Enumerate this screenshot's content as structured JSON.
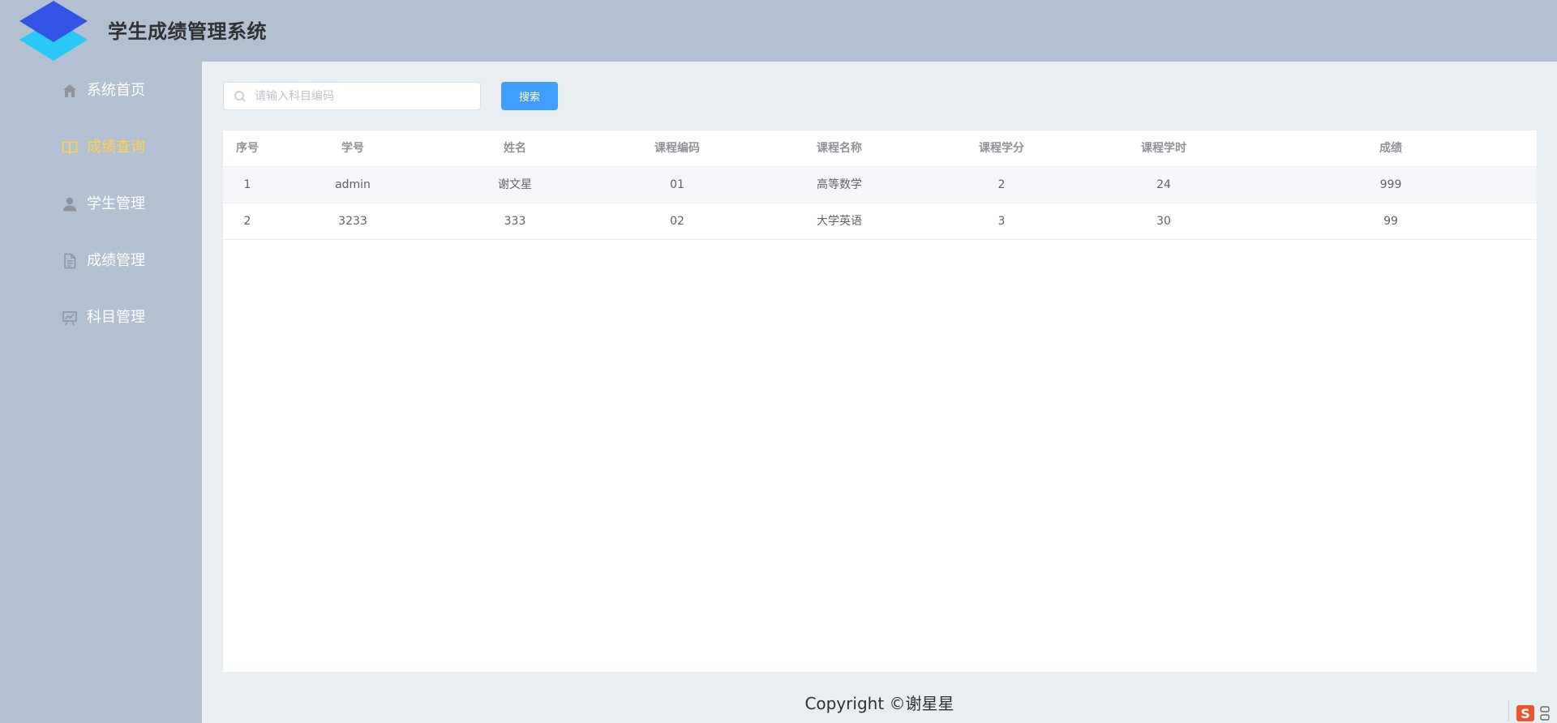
{
  "header": {
    "title": "学生成绩管理系统"
  },
  "sidebar": {
    "items": [
      {
        "label": "系统首页",
        "icon": "home-icon",
        "active": false
      },
      {
        "label": "成绩查询",
        "icon": "book-icon",
        "active": true
      },
      {
        "label": "学生管理",
        "icon": "user-icon",
        "active": false
      },
      {
        "label": "成绩管理",
        "icon": "document-icon",
        "active": false
      },
      {
        "label": "科目管理",
        "icon": "data-board-icon",
        "active": false
      }
    ]
  },
  "search": {
    "placeholder": "请输入科目编码",
    "value": "",
    "button_label": "搜索"
  },
  "table": {
    "columns": [
      "序号",
      "学号",
      "姓名",
      "课程编码",
      "课程名称",
      "课程学分",
      "课程学时",
      "成绩"
    ],
    "rows": [
      [
        "1",
        "admin",
        "谢文星",
        "01",
        "高等数学",
        "2",
        "24",
        "999"
      ],
      [
        "2",
        "3233",
        "333",
        "02",
        "大学英语",
        "3",
        "30",
        "99"
      ]
    ]
  },
  "footer": {
    "text": "Copyright ©谢星星"
  },
  "colors": {
    "header_bg": "#b3c0d1",
    "sidebar_bg": "#b3c0d1",
    "main_bg": "#e9eef3",
    "active_menu": "#ffd04b",
    "primary": "#409eff",
    "logo_top": "#3355e6",
    "logo_bottom": "#29c8f5"
  }
}
